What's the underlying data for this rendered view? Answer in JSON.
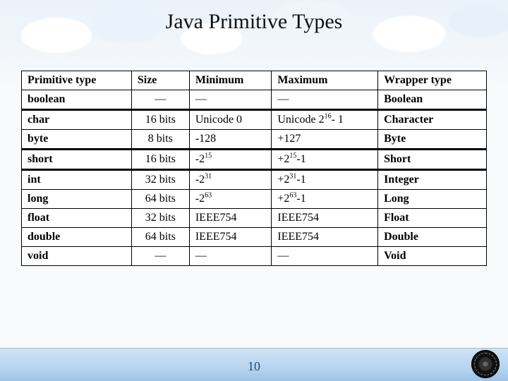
{
  "title": "Java Primitive Types",
  "page_number": "10",
  "headers": {
    "c0": "Primitive type",
    "c1": "Size",
    "c2": "Minimum",
    "c3": "Maximum",
    "c4": "Wrapper type"
  },
  "rows": [
    {
      "type": "boolean",
      "size": "—",
      "min": "—",
      "max": "—",
      "wrapper": "Boolean"
    },
    {
      "type": "char",
      "size": "16 bits",
      "min": "Unicode 0",
      "max_html": "Unicode 2<sup>16</sup>- 1",
      "wrapper": "Character"
    },
    {
      "type": "byte",
      "size": "8 bits",
      "min": "-128",
      "max": "+127",
      "wrapper": "Byte"
    },
    {
      "type": "short",
      "size": "16 bits",
      "min_html": "-2<sup>15</sup>",
      "max_html": "+2<sup>15</sup>-1",
      "wrapper": "Short"
    },
    {
      "type": "int",
      "size": "32 bits",
      "min_html": "-2<sup>31</sup>",
      "max_html": "+2<sup>31</sup>-1",
      "wrapper": "Integer"
    },
    {
      "type": "long",
      "size": "64 bits",
      "min_html": "-2<sup>63</sup>",
      "max_html": "+2<sup>63</sup>-1",
      "wrapper": "Long"
    },
    {
      "type": "float",
      "size": "32 bits",
      "min": "IEEE754",
      "max": "IEEE754",
      "wrapper": "Float"
    },
    {
      "type": "double",
      "size": "64 bits",
      "min": "IEEE754",
      "max": "IEEE754",
      "wrapper": "Double"
    },
    {
      "type": "void",
      "size": "—",
      "min": "—",
      "max": "—",
      "wrapper": "Void"
    }
  ],
  "chart_data": {
    "type": "table",
    "title": "Java Primitive Types",
    "columns": [
      "Primitive type",
      "Size",
      "Minimum",
      "Maximum",
      "Wrapper type"
    ],
    "data": [
      [
        "boolean",
        "—",
        "—",
        "—",
        "Boolean"
      ],
      [
        "char",
        "16 bits",
        "Unicode 0",
        "Unicode 2^16 - 1",
        "Character"
      ],
      [
        "byte",
        "8 bits",
        "-128",
        "+127",
        "Byte"
      ],
      [
        "short",
        "16 bits",
        "-2^15",
        "+2^15-1",
        "Short"
      ],
      [
        "int",
        "32 bits",
        "-2^31",
        "+2^31-1",
        "Integer"
      ],
      [
        "long",
        "64 bits",
        "-2^63",
        "+2^63-1",
        "Long"
      ],
      [
        "float",
        "32 bits",
        "IEEE754",
        "IEEE754",
        "Float"
      ],
      [
        "double",
        "64 bits",
        "IEEE754",
        "IEEE754",
        "Double"
      ],
      [
        "void",
        "—",
        "—",
        "—",
        "Void"
      ]
    ]
  }
}
